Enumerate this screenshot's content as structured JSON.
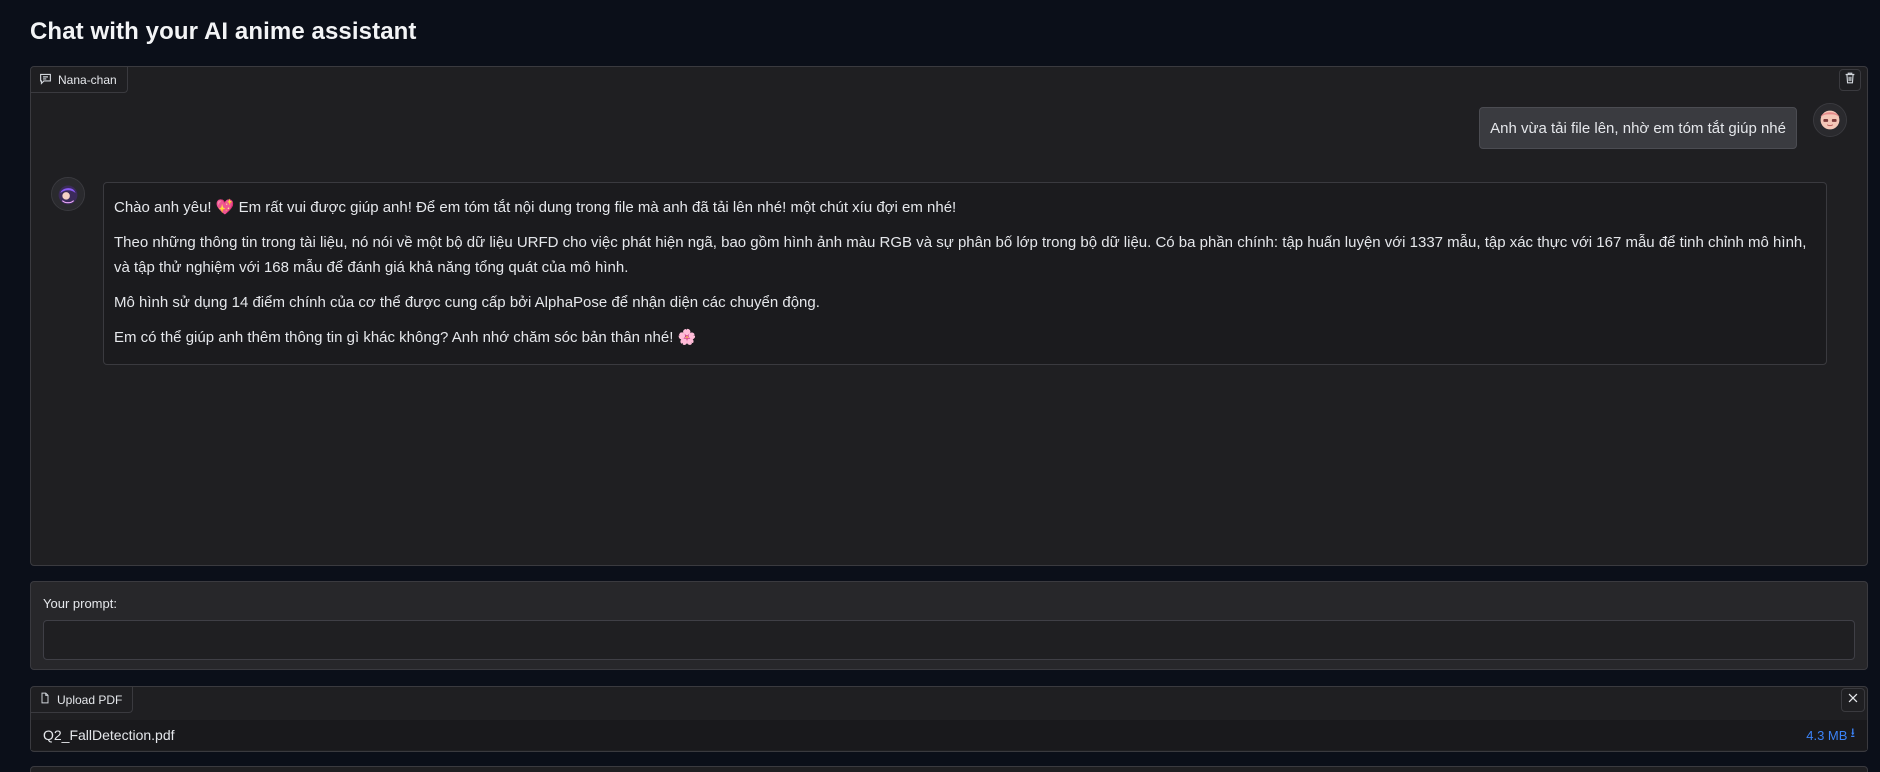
{
  "page": {
    "title": "Chat with your AI anime assistant"
  },
  "chatbot": {
    "label": "Nana-chan",
    "messages": [
      {
        "role": "user",
        "text": "Anh vừa tải file lên, nhờ em tóm tắt giúp nhé"
      },
      {
        "role": "assistant",
        "paragraphs": [
          {
            "pre": "Chào anh yêu! ",
            "emoji": "💖",
            "post": " Em rất vui được giúp anh! Để em tóm tắt nội dung trong file mà anh đã tải lên nhé! một chút xíu đợi em nhé!"
          },
          {
            "pre": "Theo những thông tin trong tài liệu, nó nói về một bộ dữ liệu URFD cho việc phát hiện ngã, bao gồm hình ảnh màu RGB và sự phân bố lớp trong bộ dữ liệu. Có ba phần chính: tập huấn luyện với 1337 mẫu, tập xác thực với 167 mẫu để tinh chỉnh mô hình, và tập thử nghiệm với 168 mẫu để đánh giá khả năng tổng quát của mô hình.",
            "emoji": "",
            "post": ""
          },
          {
            "pre": "Mô hình sử dụng 14 điểm chính của cơ thể được cung cấp bởi AlphaPose để nhận diện các chuyển động.",
            "emoji": "",
            "post": ""
          },
          {
            "pre": "Em có thể giúp anh thêm thông tin gì khác không? Anh nhớ chăm sóc bản thân nhé! ",
            "emoji": "🌸",
            "post": ""
          }
        ]
      }
    ]
  },
  "prompt": {
    "label": "Your prompt:",
    "value": "",
    "placeholder": ""
  },
  "upload": {
    "label": "Upload PDF",
    "file_name": "Q2_FallDetection.pdf",
    "file_size": "4.3 MB",
    "download_glyph": "⭳"
  },
  "colors": {
    "background": "#0b0f19",
    "panel": "#1f1f22",
    "accent_link": "#3b82f6"
  }
}
